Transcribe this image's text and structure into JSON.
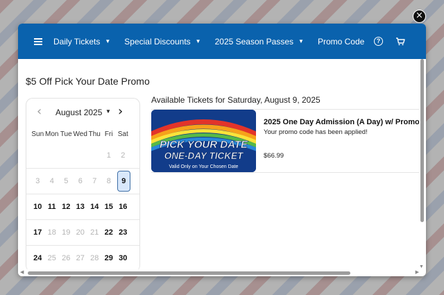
{
  "nav": {
    "items": [
      {
        "label": "Daily Tickets",
        "dropdown": true
      },
      {
        "label": "Special Discounts",
        "dropdown": true
      },
      {
        "label": "2025 Season Passes",
        "dropdown": true
      },
      {
        "label": "Promo Code",
        "dropdown": false
      }
    ],
    "icons": [
      "menu-icon",
      "help-icon",
      "cart-icon"
    ],
    "color": "#0a62ad"
  },
  "page_title": "$5 Off Pick Your Date Promo",
  "calendar": {
    "month_label": "August 2025",
    "weekdays": [
      "Sun",
      "Mon",
      "Tue",
      "Wed",
      "Thu",
      "Fri",
      "Sat"
    ],
    "weeks": [
      [
        null,
        null,
        null,
        null,
        null,
        {
          "d": "1",
          "s": "dis"
        },
        {
          "d": "2",
          "s": "dis"
        }
      ],
      [
        {
          "d": "3",
          "s": "dis"
        },
        {
          "d": "4",
          "s": "dis"
        },
        {
          "d": "5",
          "s": "dis"
        },
        {
          "d": "6",
          "s": "dis"
        },
        {
          "d": "7",
          "s": "dis"
        },
        {
          "d": "8",
          "s": "dis"
        },
        {
          "d": "9",
          "s": "sel"
        }
      ],
      [
        {
          "d": "10",
          "s": "en"
        },
        {
          "d": "11",
          "s": "en"
        },
        {
          "d": "12",
          "s": "en"
        },
        {
          "d": "13",
          "s": "en"
        },
        {
          "d": "14",
          "s": "en"
        },
        {
          "d": "15",
          "s": "en"
        },
        {
          "d": "16",
          "s": "en"
        }
      ],
      [
        {
          "d": "17",
          "s": "en"
        },
        {
          "d": "18",
          "s": "dis"
        },
        {
          "d": "19",
          "s": "dis"
        },
        {
          "d": "20",
          "s": "dis"
        },
        {
          "d": "21",
          "s": "dis"
        },
        {
          "d": "22",
          "s": "en"
        },
        {
          "d": "23",
          "s": "en"
        }
      ],
      [
        {
          "d": "24",
          "s": "en"
        },
        {
          "d": "25",
          "s": "dis"
        },
        {
          "d": "26",
          "s": "dis"
        },
        {
          "d": "27",
          "s": "dis"
        },
        {
          "d": "28",
          "s": "dis"
        },
        {
          "d": "29",
          "s": "en"
        },
        {
          "d": "30",
          "s": "en"
        }
      ]
    ]
  },
  "available_title": "Available Tickets for Saturday, August 9, 2025",
  "ticket": {
    "image_line1": "PICK YOUR DATE",
    "image_line2": "ONE-DAY TICKET",
    "image_line3": "Valid Only on Your Chosen Date",
    "name": "2025 One Day Admission (A Day) w/ Promo",
    "message": "Your promo code has been applied!",
    "price": "$66.99"
  }
}
